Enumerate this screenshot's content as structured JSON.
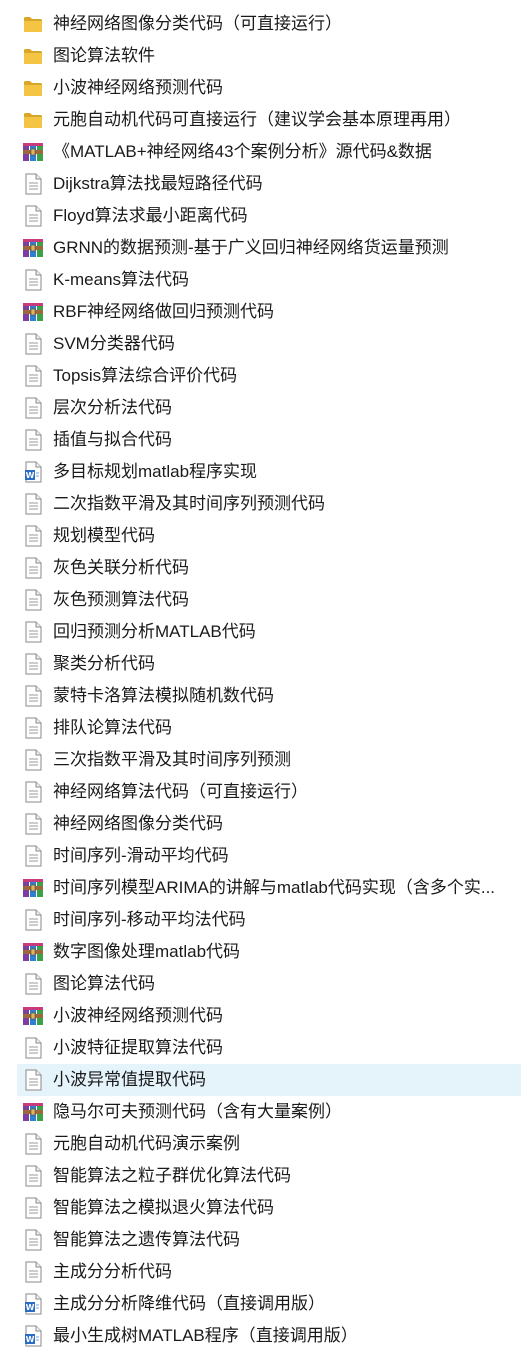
{
  "files": [
    {
      "name": "神经网络图像分类代码（可直接运行）",
      "icon": "folder-icon",
      "selected": false
    },
    {
      "name": "图论算法软件",
      "icon": "folder-icon",
      "selected": false
    },
    {
      "name": "小波神经网络预测代码",
      "icon": "folder-icon",
      "selected": false
    },
    {
      "name": "元胞自动机代码可直接运行（建议学会基本原理再用）",
      "icon": "folder-icon",
      "selected": false
    },
    {
      "name": "《MATLAB+神经网络43个案例分析》源代码&数据",
      "icon": "archive-icon",
      "selected": false
    },
    {
      "name": "Dijkstra算法找最短路径代码",
      "icon": "document-icon",
      "selected": false
    },
    {
      "name": "Floyd算法求最小距离代码",
      "icon": "document-icon",
      "selected": false
    },
    {
      "name": "GRNN的数据预测-基于广义回归神经网络货运量预测",
      "icon": "archive-icon",
      "selected": false
    },
    {
      "name": "K-means算法代码",
      "icon": "document-icon",
      "selected": false
    },
    {
      "name": "RBF神经网络做回归预测代码",
      "icon": "archive-icon",
      "selected": false
    },
    {
      "name": "SVM分类器代码",
      "icon": "document-icon",
      "selected": false
    },
    {
      "name": "Topsis算法综合评价代码",
      "icon": "document-icon",
      "selected": false
    },
    {
      "name": "层次分析法代码",
      "icon": "document-icon",
      "selected": false
    },
    {
      "name": "插值与拟合代码",
      "icon": "document-icon",
      "selected": false
    },
    {
      "name": "多目标规划matlab程序实现",
      "icon": "word-document-icon",
      "selected": false
    },
    {
      "name": "二次指数平滑及其时间序列预测代码",
      "icon": "document-icon",
      "selected": false
    },
    {
      "name": "规划模型代码",
      "icon": "document-icon",
      "selected": false
    },
    {
      "name": "灰色关联分析代码",
      "icon": "document-icon",
      "selected": false
    },
    {
      "name": "灰色预测算法代码",
      "icon": "document-icon",
      "selected": false
    },
    {
      "name": "回归预测分析MATLAB代码",
      "icon": "document-icon",
      "selected": false
    },
    {
      "name": "聚类分析代码",
      "icon": "document-icon",
      "selected": false
    },
    {
      "name": "蒙特卡洛算法模拟随机数代码",
      "icon": "document-icon",
      "selected": false
    },
    {
      "name": "排队论算法代码",
      "icon": "document-icon",
      "selected": false
    },
    {
      "name": "三次指数平滑及其时间序列预测",
      "icon": "document-icon",
      "selected": false
    },
    {
      "name": "神经网络算法代码（可直接运行）",
      "icon": "document-icon",
      "selected": false
    },
    {
      "name": "神经网络图像分类代码",
      "icon": "document-icon",
      "selected": false
    },
    {
      "name": "时间序列-滑动平均代码",
      "icon": "document-icon",
      "selected": false
    },
    {
      "name": "时间序列模型ARIMA的讲解与matlab代码实现（含多个实...",
      "icon": "archive-icon",
      "selected": false
    },
    {
      "name": "时间序列-移动平均法代码",
      "icon": "document-icon",
      "selected": false
    },
    {
      "name": "数字图像处理matlab代码",
      "icon": "archive-icon",
      "selected": false
    },
    {
      "name": "图论算法代码",
      "icon": "document-icon",
      "selected": false
    },
    {
      "name": "小波神经网络预测代码",
      "icon": "archive-icon",
      "selected": false
    },
    {
      "name": "小波特征提取算法代码",
      "icon": "document-icon",
      "selected": false
    },
    {
      "name": "小波异常值提取代码",
      "icon": "document-icon",
      "selected": true
    },
    {
      "name": "隐马尔可夫预测代码（含有大量案例）",
      "icon": "archive-icon",
      "selected": false
    },
    {
      "name": "元胞自动机代码演示案例",
      "icon": "document-icon",
      "selected": false
    },
    {
      "name": "智能算法之粒子群优化算法代码",
      "icon": "document-icon",
      "selected": false
    },
    {
      "name": "智能算法之模拟退火算法代码",
      "icon": "document-icon",
      "selected": false
    },
    {
      "name": "智能算法之遗传算法代码",
      "icon": "document-icon",
      "selected": false
    },
    {
      "name": "主成分分析代码",
      "icon": "document-icon",
      "selected": false
    },
    {
      "name": "主成分分析降维代码（直接调用版）",
      "icon": "word-document-icon",
      "selected": false
    },
    {
      "name": "最小生成树MATLAB程序（直接调用版）",
      "icon": "word-document-icon",
      "selected": false
    }
  ],
  "colors": {
    "folder": "#f4c542",
    "folder_dark": "#d9a62a",
    "selection": "#e5f3fb",
    "word_blue": "#2b6cc4",
    "archive_purple": "#7a3fa0",
    "archive_blue": "#2f7fd0",
    "archive_band": "#9a6a3a"
  }
}
